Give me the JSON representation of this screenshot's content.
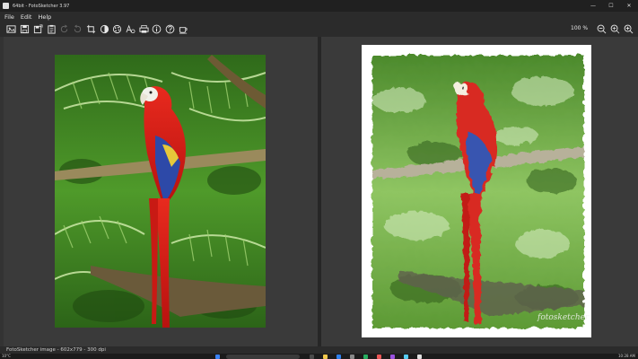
{
  "window": {
    "title": "64bit - FotoSketcher 3.97",
    "controls": {
      "minimize": "—",
      "maximize": "☐",
      "close": "✕"
    }
  },
  "menu": {
    "file": "File",
    "edit": "Edit",
    "help": "Help"
  },
  "toolbar": {
    "zoom_level": "100 %",
    "icons": [
      "open-image-icon",
      "save-icon",
      "save-as-icon",
      "paste-icon",
      "undo-icon",
      "redo-icon",
      "crop-icon",
      "contrast-icon",
      "palette-icon",
      "text-effect-icon",
      "print-icon",
      "info-icon",
      "help-icon",
      "coffee-icon",
      "zoom-out-icon",
      "zoom-reset-icon",
      "zoom-in-icon"
    ]
  },
  "status": {
    "text": "FotoSketcher image - 602x779 - 300 dpi"
  },
  "taskbar": {
    "weather": "10°C",
    "clock": "10:28 AM"
  },
  "images": {
    "original": {
      "subject": "scarlet macaw on branch"
    },
    "result": {
      "watermark": "fotosketcher"
    }
  },
  "colors": {
    "accent_red": "#d4201c",
    "foliage_green": "#3f8e2a",
    "background": "#333333"
  }
}
